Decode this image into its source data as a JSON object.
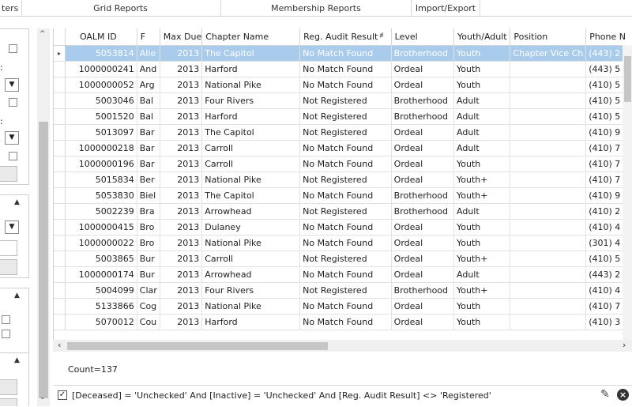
{
  "menu": {
    "tabs": [
      {
        "label": "ters"
      },
      {
        "label": "Grid Reports"
      },
      {
        "label": "Membership Reports"
      },
      {
        "label": "Import/Export"
      }
    ]
  },
  "left_panel": {
    "label1": ":",
    "label2": ":"
  },
  "grid": {
    "columns": [
      {
        "label": "OALM ID"
      },
      {
        "label": "F"
      },
      {
        "label": "Max Due"
      },
      {
        "label": "Chapter Name"
      },
      {
        "label": "Reg. Audit Result"
      },
      {
        "label": "Level"
      },
      {
        "label": "Youth/Adult"
      },
      {
        "label": "Position"
      },
      {
        "label": "Phone N"
      }
    ],
    "filtered_column_icon": "filter-icon",
    "selected_row_index": 0,
    "row_indicator_icon": "row-pointer-icon",
    "rows": [
      {
        "id": "5053814",
        "f": "Alle",
        "due": "2013",
        "chapter": "The Capitol",
        "audit": "No Match Found",
        "level": "Brotherhood",
        "youth": "Youth",
        "position": "Chapter Vice Ch",
        "phone": "(443) 2"
      },
      {
        "id": "1000000241",
        "f": "And",
        "due": "2013",
        "chapter": "Harford",
        "audit": "No Match Found",
        "level": "Ordeal",
        "youth": "Youth",
        "position": "",
        "phone": "(443) 5"
      },
      {
        "id": "1000000052",
        "f": "Arg",
        "due": "2013",
        "chapter": "National Pike",
        "audit": "No Match Found",
        "level": "Ordeal",
        "youth": "Youth",
        "position": "",
        "phone": "(410) 5"
      },
      {
        "id": "5003046",
        "f": "Bal",
        "due": "2013",
        "chapter": "Four Rivers",
        "audit": "Not Registered",
        "level": "Brotherhood",
        "youth": "Adult",
        "position": "",
        "phone": "(410) 5"
      },
      {
        "id": "5001520",
        "f": "Bal",
        "due": "2013",
        "chapter": "Harford",
        "audit": "Not Registered",
        "level": "Brotherhood",
        "youth": "Adult",
        "position": "",
        "phone": "(410) 5"
      },
      {
        "id": "5013097",
        "f": "Bar",
        "due": "2013",
        "chapter": "The Capitol",
        "audit": "Not Registered",
        "level": "Ordeal",
        "youth": "Adult",
        "position": "",
        "phone": "(410) 9"
      },
      {
        "id": "1000000218",
        "f": "Bar",
        "due": "2013",
        "chapter": "Carroll",
        "audit": "No Match Found",
        "level": "Ordeal",
        "youth": "Adult",
        "position": "",
        "phone": "(410) 7"
      },
      {
        "id": "1000000196",
        "f": "Bar",
        "due": "2013",
        "chapter": "Carroll",
        "audit": "No Match Found",
        "level": "Ordeal",
        "youth": "Youth",
        "position": "",
        "phone": "(410) 7"
      },
      {
        "id": "5015834",
        "f": "Ber",
        "due": "2013",
        "chapter": "National Pike",
        "audit": "Not Registered",
        "level": "Ordeal",
        "youth": "Youth+",
        "position": "",
        "phone": "(410) 7"
      },
      {
        "id": "5053830",
        "f": "Biel",
        "due": "2013",
        "chapter": "The Capitol",
        "audit": "No Match Found",
        "level": "Brotherhood",
        "youth": "Youth+",
        "position": "",
        "phone": "(410) 9"
      },
      {
        "id": "5002239",
        "f": "Bra",
        "due": "2013",
        "chapter": "Arrowhead",
        "audit": "Not Registered",
        "level": "Brotherhood",
        "youth": "Adult",
        "position": "",
        "phone": "(410) 2"
      },
      {
        "id": "1000000415",
        "f": "Bro",
        "due": "2013",
        "chapter": "Dulaney",
        "audit": "No Match Found",
        "level": "Ordeal",
        "youth": "Youth",
        "position": "",
        "phone": "(410) 4"
      },
      {
        "id": "1000000022",
        "f": "Bro",
        "due": "2013",
        "chapter": "National Pike",
        "audit": "No Match Found",
        "level": "Ordeal",
        "youth": "Youth",
        "position": "",
        "phone": "(301) 4"
      },
      {
        "id": "5003865",
        "f": "Bur",
        "due": "2013",
        "chapter": "Carroll",
        "audit": "Not Registered",
        "level": "Ordeal",
        "youth": "Youth+",
        "position": "",
        "phone": "(410) 5"
      },
      {
        "id": "1000000174",
        "f": "Bur",
        "due": "2013",
        "chapter": "Arrowhead",
        "audit": "No Match Found",
        "level": "Ordeal",
        "youth": "Adult",
        "position": "",
        "phone": "(443) 2"
      },
      {
        "id": "5004099",
        "f": "Clar",
        "due": "2013",
        "chapter": "Four Rivers",
        "audit": "Not Registered",
        "level": "Brotherhood",
        "youth": "Youth+",
        "position": "",
        "phone": "(410) 4"
      },
      {
        "id": "5133866",
        "f": "Cog",
        "due": "2013",
        "chapter": "National Pike",
        "audit": "No Match Found",
        "level": "Ordeal",
        "youth": "Youth",
        "position": "",
        "phone": "(410) 7"
      },
      {
        "id": "5070012",
        "f": "Cou",
        "due": "2013",
        "chapter": "Harford",
        "audit": "No Match Found",
        "level": "Ordeal",
        "youth": "Youth",
        "position": "",
        "phone": "(410) 3"
      }
    ]
  },
  "footer": {
    "count": "Count=137",
    "filter_expression": "[Deceased] = 'Unchecked' And [Inactive] = 'Unchecked' And [Reg. Audit Result] <> 'Registered'",
    "filter_enabled": true
  },
  "colors": {
    "selection": "#a9cbec",
    "grid_line": "#e2e2e2"
  }
}
